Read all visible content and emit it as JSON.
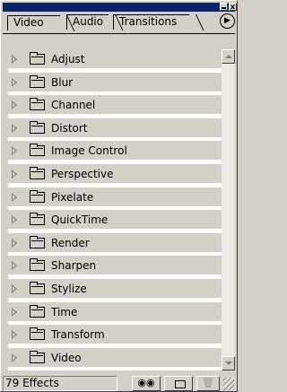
{
  "window": {
    "minimize_glyph": "",
    "close_glyph": "x"
  },
  "tabs": [
    {
      "label": "Video",
      "selected": true
    },
    {
      "label": "Audio",
      "selected": false
    },
    {
      "label": "Transitions",
      "selected": false
    }
  ],
  "tab_menu_glyph": "▶",
  "effects": [
    {
      "label": "Adjust"
    },
    {
      "label": "Blur"
    },
    {
      "label": "Channel"
    },
    {
      "label": "Distort"
    },
    {
      "label": "Image Control"
    },
    {
      "label": "Perspective"
    },
    {
      "label": "Pixelate"
    },
    {
      "label": "QuickTime"
    },
    {
      "label": "Render"
    },
    {
      "label": "Sharpen"
    },
    {
      "label": "Stylize"
    },
    {
      "label": "Time"
    },
    {
      "label": "Transform"
    },
    {
      "label": "Video"
    }
  ],
  "status": {
    "count_text": "79 Effects",
    "find_glyph": "🔍",
    "trash_glyph": "🗑"
  },
  "colors": {
    "titlebar": "#0a246a",
    "face": "#d4d0c8",
    "panel": "#ffffff"
  }
}
